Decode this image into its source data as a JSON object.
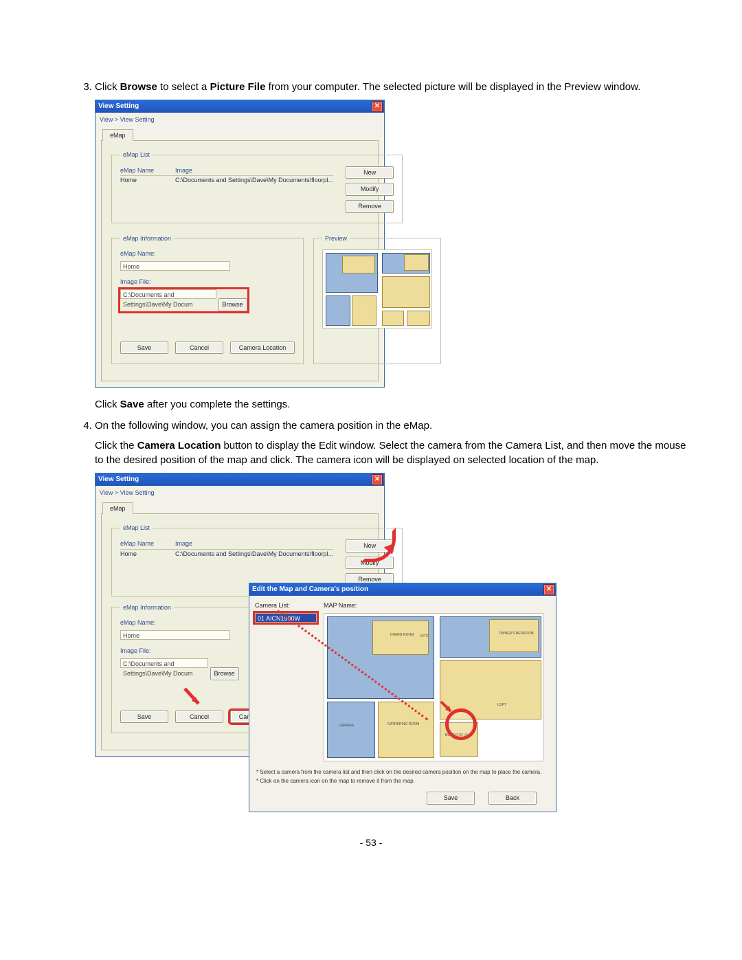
{
  "steps": {
    "s3a": "Click ",
    "s3b": "Browse",
    "s3c": " to select a ",
    "s3d": "Picture File",
    "s3e": " from your computer. The selected picture will be displayed in the Preview window.",
    "s3after_a": "Click ",
    "s3after_b": "Save",
    "s3after_c": " after you complete the settings.",
    "s4a": "On the following window, you can assign the camera position in the eMap.",
    "s4b_a": "Click the ",
    "s4b_b": "Camera Location",
    "s4b_c": " button to display the Edit window. Select the camera from the Camera List, and then move the mouse to the desired position of the map and click. The camera icon will be displayed on selected location of the map."
  },
  "view_window": {
    "title": "View Setting",
    "breadcrumb": "View > View Setting",
    "tab": "eMap",
    "emap_list_legend": "eMap List",
    "col_name": "eMap Name",
    "col_image": "Image",
    "row_name": "Home",
    "row_image": "C:\\Documents and Settings\\Dave\\My Documents\\floorpl...",
    "btn_new": "New",
    "btn_modify": "Modify",
    "btn_remove": "Remove",
    "emap_info_legend": "eMap Information",
    "lbl_emap_name": "eMap Name:",
    "val_emap_name": "Home",
    "lbl_image_file": "Image File:",
    "val_image_file": "C:\\Documents and Settings\\Dave\\My Docum",
    "btn_browse": "Browse",
    "preview_legend": "Preview",
    "btn_save": "Save",
    "btn_cancel": "Cancel",
    "btn_camloc": "Camera Location"
  },
  "edit_window": {
    "title": "Edit the Map and Camera's position",
    "lbl_camlist": "Camera List:",
    "lbl_mapname": "MAP Name:",
    "camera_item": "01 AICN1500W",
    "note1": "* Select a camera from the camera list and then click on the desired camera position on the map to place the camera.",
    "note2": "* Click on the camera icon on the map to remove it from the map.",
    "btn_save": "Save",
    "btn_back": "Back"
  },
  "floorplan_labels": {
    "dining": "DINING ROOM",
    "garage": "GARAGE",
    "gathering": "GATHERING ROOM",
    "bedroom": "BEDROOM #2",
    "loft": "LOFT",
    "owner": "OWNER'S BEDROOM",
    "kitc": "KITC."
  },
  "page_number": "- 53 -"
}
